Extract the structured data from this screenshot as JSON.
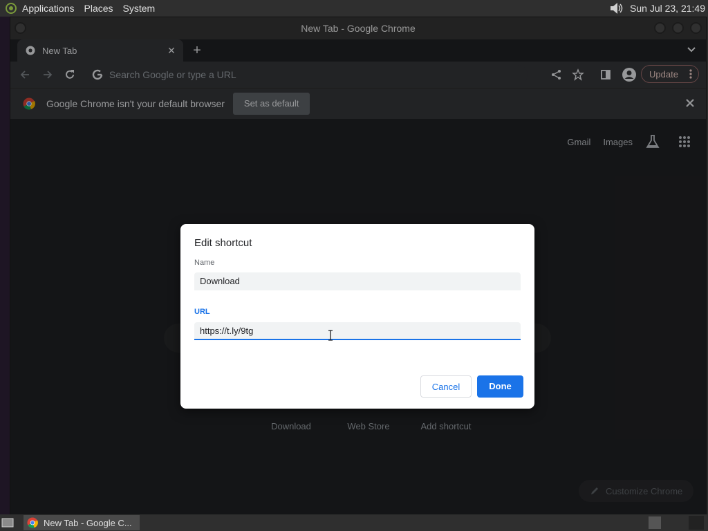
{
  "panel": {
    "menus": [
      "Applications",
      "Places",
      "System"
    ],
    "clock": "Sun Jul 23, 21:49"
  },
  "window": {
    "title": "New Tab - Google Chrome"
  },
  "tab": {
    "label": "New Tab"
  },
  "toolbar": {
    "omnibox_placeholder": "Search Google or type a URL",
    "update_label": "Update"
  },
  "infobar": {
    "message": "Google Chrome isn't your default browser",
    "set_default_label": "Set as default"
  },
  "ntp": {
    "links": [
      "Gmail",
      "Images"
    ],
    "tiles": [
      "Download",
      "Web Store",
      "Add shortcut"
    ],
    "customize_label": "Customize Chrome"
  },
  "dialog": {
    "title": "Edit shortcut",
    "name_label": "Name",
    "name_value": "Download",
    "url_label": "URL",
    "url_value": "https://t.ly/9tg",
    "cancel_label": "Cancel",
    "done_label": "Done"
  },
  "taskbar": {
    "item_label": "New Tab - Google C..."
  },
  "colors": {
    "accent": "#1a73e8",
    "update_border": "#9a6a6a"
  }
}
